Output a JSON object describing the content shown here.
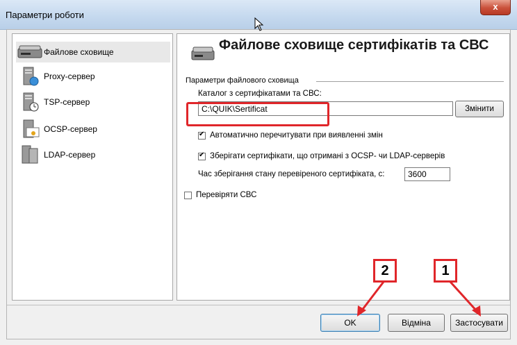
{
  "window": {
    "title": "Параметри роботи",
    "close_label": "x"
  },
  "nav": {
    "items": [
      {
        "label": "Файлове сховище",
        "icon": "drive-icon"
      },
      {
        "label": "Proxy-сервер",
        "icon": "proxy-server-icon"
      },
      {
        "label": "TSP-сервер",
        "icon": "tsp-server-icon"
      },
      {
        "label": "OCSP-сервер",
        "icon": "ocsp-certificate-icon"
      },
      {
        "label": "LDAP-сервер",
        "icon": "ldap-server-icon"
      }
    ],
    "selected": 0
  },
  "panel": {
    "title": "Файлове сховище сертифікатів та СВС",
    "group_label": "Параметри файлового сховища",
    "dir_label": "Каталог з сертифікатами та СВС:",
    "dir_value": "C:\\QUIK\\Sertificat",
    "change_button": "Змінити",
    "auto_reread_label": "Автоматично перечитувати при виявленні змін",
    "auto_reread_checked": true,
    "save_certs_label": "Зберігати сертифікати, що отримані з OCSP- чи LDAP-серверів",
    "save_certs_checked": true,
    "time_label": "Час зберігання стану перевіреного сертифіката, с:",
    "time_value": "3600",
    "check_crl_label": "Перевіряти СВС",
    "check_crl_checked": false
  },
  "buttons": {
    "ok": "OK",
    "cancel": "Відміна",
    "apply": "Застосувати"
  },
  "annotations": {
    "badge1": "1",
    "badge2": "2",
    "highlight_color": "#e0262a"
  }
}
